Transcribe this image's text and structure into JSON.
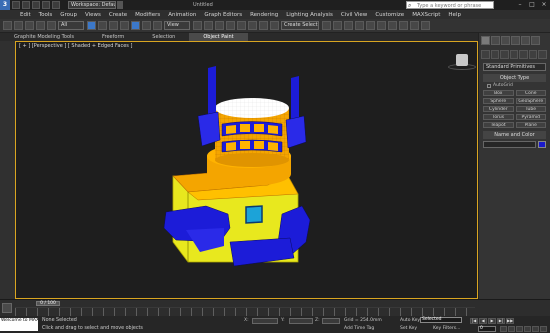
{
  "titlebar": {
    "workspace": "Workspace: Default",
    "title": "Untitled",
    "search_placeholder": "Type a keyword or phrase",
    "min": "–",
    "max": "□",
    "close": "×"
  },
  "menu": [
    "Edit",
    "Tools",
    "Group",
    "Views",
    "Create",
    "Modifiers",
    "Animation",
    "Graph Editors",
    "Rendering",
    "Lighting Analysis",
    "Civil View",
    "Customize",
    "MAXScript",
    "Help"
  ],
  "toolbar": {
    "filter": "All",
    "ref_coord": "View",
    "selection_set": "Create Selection Se"
  },
  "ribbon": {
    "tabs": [
      "Graphite Modeling Tools",
      "Freeform",
      "Selection",
      "Object Paint"
    ],
    "active": "Object Paint"
  },
  "viewport": {
    "label": "[ + ] [Perspective ] [ Shaded + Edged Faces ]"
  },
  "command_panel": {
    "category": "Standard Primitives",
    "rollout_object_type": "Object Type",
    "autogrid": "AutoGrid",
    "buttons": [
      "Box",
      "Cone",
      "Sphere",
      "GeoSphere",
      "Cylinder",
      "Tube",
      "Torus",
      "Pyramid",
      "Teapot",
      "Plane"
    ],
    "rollout_name_color": "Name and Color",
    "object_color": "#1a1acc"
  },
  "timeline": {
    "frame_slider": "0 / 100"
  },
  "status": {
    "maxscript": "Welcome to MAX:",
    "selection": "None Selected",
    "prompt": "Click and drag to select and move objects",
    "x_label": "X:",
    "y_label": "Y:",
    "z_label": "Z:",
    "grid": "Grid = 254.0mm",
    "add_time_tag": "Add Time Tag",
    "auto_key": "Auto Key",
    "set_key": "Set Key",
    "selected": "Selected",
    "key_filters": "Key Filters...",
    "frame": "0"
  }
}
